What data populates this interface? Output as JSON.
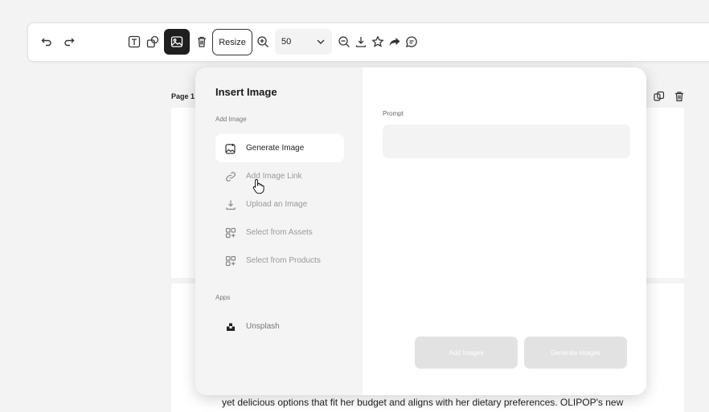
{
  "toolbar": {
    "icons": [
      "undo-icon",
      "redo-icon",
      "text-icon",
      "shapes-icon",
      "image-icon",
      "trash-icon",
      "zoom-in-icon",
      "zoom-out-icon",
      "download-icon",
      "star-icon",
      "share-icon",
      "comment-icon"
    ],
    "resize_label": "Resize",
    "zoom_value": "50"
  },
  "page": {
    "label": "Page 1 -",
    "text_line": "yet delicious options that fit her budget and aligns with her dietary preferences. OLIPOP's new"
  },
  "modal": {
    "title": "Insert Image",
    "add_image_section": "Add Image",
    "items": [
      {
        "label": "Generate Image",
        "icon": "sparkle-image-icon"
      },
      {
        "label": "Add Image Link",
        "icon": "link-icon"
      },
      {
        "label": "Upload an Image",
        "icon": "upload-icon"
      },
      {
        "label": "Select from Assets",
        "icon": "grid-icon"
      },
      {
        "label": "Select from Products",
        "icon": "grid-icon"
      }
    ],
    "apps_section": "Apps",
    "apps": [
      {
        "label": "Unsplash",
        "icon": "unsplash-icon"
      }
    ],
    "prompt_label": "Prompt",
    "prompt_value": "",
    "add_images_button": "Add Images",
    "generate_images_button": "Generate Images"
  },
  "colors": {
    "active_tool_bg": "#1f1f1f",
    "disabled_button_bg": "#e2e2e2",
    "sidebar_bg": "#f4f4f4"
  }
}
